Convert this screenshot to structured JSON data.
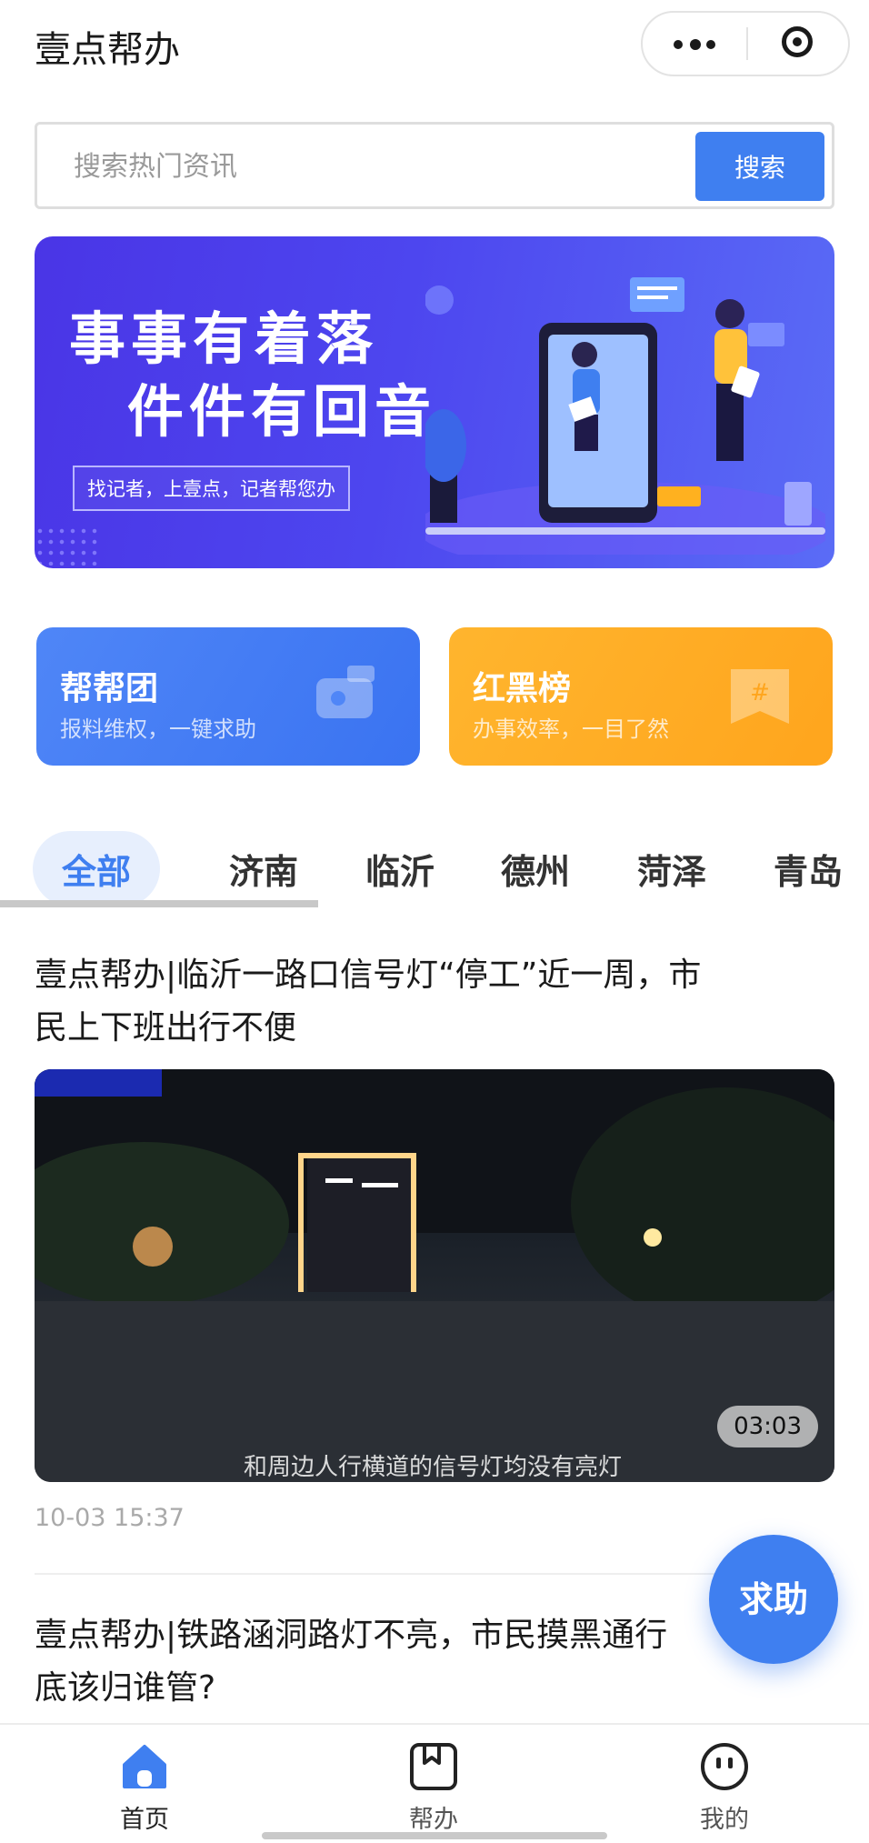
{
  "app": {
    "title": "壹点帮办"
  },
  "search": {
    "placeholder": "搜索热门资讯",
    "button_label": "搜索"
  },
  "banner": {
    "line1": "事事有着落",
    "line2": "件件有回音",
    "tagline": "找记者，上壹点，记者帮您办"
  },
  "cards": [
    {
      "title": "帮帮团",
      "subtitle": "报料维权，一键求助",
      "icon": "camera-icon",
      "color": "#4f86f7"
    },
    {
      "title": "红黑榜",
      "subtitle": "办事效率，一目了然",
      "icon": "hashtag-bookmark-icon",
      "color": "#ffad25"
    }
  ],
  "tabs": {
    "items": [
      "全部",
      "济南",
      "临沂",
      "德州",
      "菏泽",
      "青岛"
    ],
    "active_index": 0
  },
  "articles": [
    {
      "title_line1": "壹点帮办|临沂一路口信号灯“停工”近一周，市",
      "title_line2": "民上下班出行不便",
      "video_duration": "03:03",
      "video_caption": "和周边人行横道的信号灯均没有亮灯",
      "time": "10-03 15:37"
    },
    {
      "title_line1": "壹点帮办|铁路涵洞路灯不亮，市民摸黑通行",
      "title_line2": "底该归谁管?"
    }
  ],
  "fab": {
    "label": "求助"
  },
  "tabbar": {
    "items": [
      {
        "label": "首页",
        "icon": "home-icon",
        "active": true
      },
      {
        "label": "帮办",
        "icon": "bookmark-icon",
        "active": false
      },
      {
        "label": "我的",
        "icon": "smiley-icon",
        "active": false
      }
    ]
  },
  "colors": {
    "accent": "#3f7ff0",
    "orange": "#ffad25",
    "banner": "#4a3ce8"
  }
}
